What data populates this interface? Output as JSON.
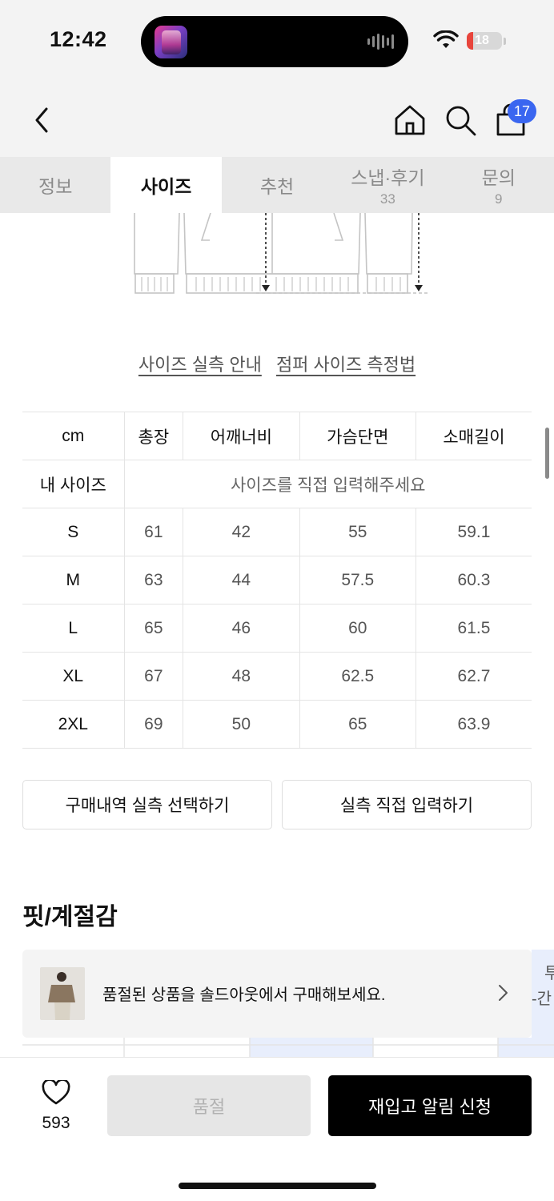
{
  "status": {
    "time": "12:42",
    "battery": "18",
    "battery_level": 0.18
  },
  "nav": {
    "cart_badge": "17"
  },
  "tabs": [
    {
      "label": "정보",
      "count": ""
    },
    {
      "label": "사이즈",
      "count": ""
    },
    {
      "label": "추천",
      "count": ""
    },
    {
      "label": "스냅·후기",
      "count": "33"
    },
    {
      "label": "문의",
      "count": "9"
    }
  ],
  "links": {
    "size_guide": "사이즈 실측 안내",
    "jumper_measure": "점퍼 사이즈 측정법"
  },
  "size_table": {
    "headers": [
      "cm",
      "총장",
      "어깨너비",
      "가슴단면",
      "소매길이"
    ],
    "my_size_label": "내 사이즈",
    "my_size_hint": "사이즈를 직접 입력해주세요",
    "rows": [
      {
        "size": "S",
        "values": [
          "61",
          "42",
          "55",
          "59.1"
        ]
      },
      {
        "size": "M",
        "values": [
          "63",
          "44",
          "57.5",
          "60.3"
        ]
      },
      {
        "size": "L",
        "values": [
          "65",
          "46",
          "60",
          "61.5"
        ]
      },
      {
        "size": "XL",
        "values": [
          "67",
          "48",
          "62.5",
          "62.7"
        ]
      },
      {
        "size": "2XL",
        "values": [
          "69",
          "50",
          "65",
          "63.9"
        ]
      }
    ]
  },
  "actions": {
    "purchase_history": "구매내역 실측 선택하기",
    "manual_input": "실측 직접 입력하기"
  },
  "section": {
    "fit_title": "핏/계절감"
  },
  "banner": {
    "text": "품절된 상품을 솔드아웃에서 구매해보세요.",
    "peek_top": "투",
    "peek_bottom": "-간"
  },
  "bottom": {
    "like_count": "593",
    "soldout": "품절",
    "restock": "재입고 알림 신청"
  }
}
